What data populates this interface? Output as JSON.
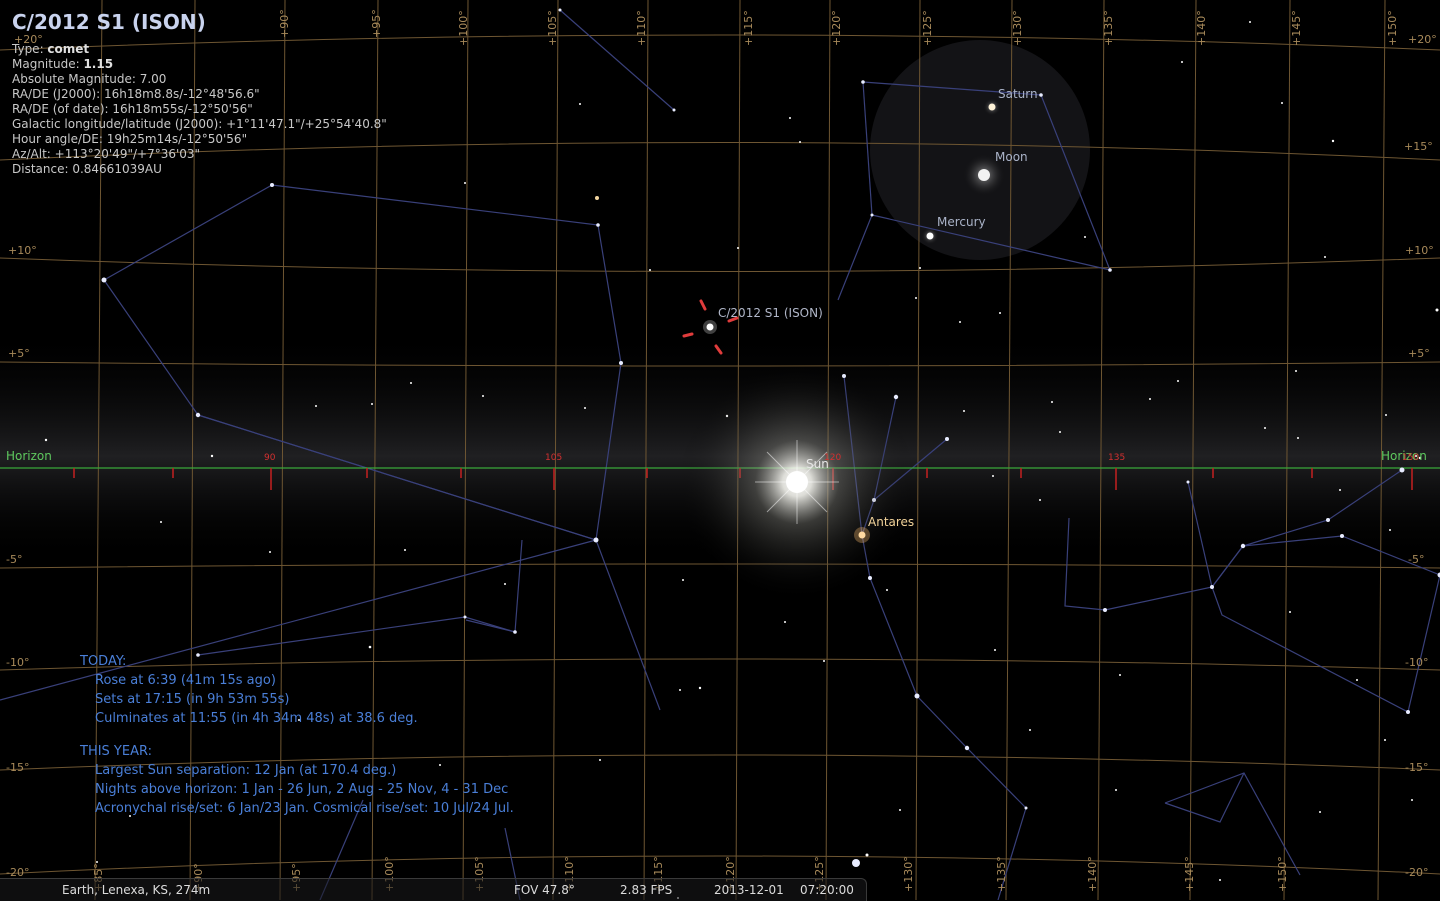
{
  "object_info": {
    "title": "C/2012 S1 (ISON)",
    "type_label": "Type: ",
    "type_value": "comet",
    "magnitude_label": "Magnitude: ",
    "magnitude_value": "1.15",
    "lines": [
      "Absolute Magnitude: 7.00",
      "RA/DE (J2000): 16h18m8.8s/-12°48'56.6\"",
      "RA/DE (of date): 16h18m55s/-12°50'56\"",
      "Galactic longitude/latitude (J2000): +1°11'47.1\"/+25°54'40.8\"",
      "Hour angle/DE: 19h25m14s/-12°50'56\"",
      "Az/Alt: +113°20'49\"/+7°36'03\"",
      "Distance: 0.84661039AU"
    ]
  },
  "sky_labels": {
    "saturn": "Saturn",
    "moon": "Moon",
    "mercury": "Mercury",
    "comet": "C/2012 S1 (ISON)",
    "sun": "Sun",
    "antares": "Antares",
    "horizon_left": "Horizon",
    "horizon_right": "Horizon"
  },
  "horizon_ticks": [
    "90",
    "105",
    "120",
    "135",
    "150"
  ],
  "alt_labels_left": [
    "+20°",
    "+15°",
    "+10°",
    "+5°",
    "-5°",
    "-10°",
    "-15°",
    "-20°"
  ],
  "alt_labels_right": [
    "+20°",
    "+15°",
    "+10°",
    "+5°",
    "-5°",
    "-10°",
    "-15°",
    "-20°"
  ],
  "az_labels_top": [
    "+90°",
    "+95°",
    "+100°",
    "+105°",
    "+110°",
    "+115°",
    "+120°",
    "+125°",
    "+130°",
    "+135°",
    "+140°",
    "+145°",
    "+150°"
  ],
  "az_labels_bottom": [
    "+85°",
    "+90°",
    "+95°",
    "+100°",
    "+105°",
    "+110°",
    "+115°",
    "+120°",
    "+125°",
    "+130°",
    "+135°",
    "+140°",
    "+145°",
    "+150°"
  ],
  "today_panel": {
    "today_heading": "TODAY:",
    "rose": "Rose at 6:39 (41m 15s ago)",
    "sets": "Sets at 17:15 (in 9h 53m 55s)",
    "culminates": "Culminates at 11:55 (in 4h 34m 48s) at 38.6 deg.",
    "year_heading": "THIS YEAR:",
    "largest_sep": "Largest Sun separation: 12 Jan (at 170.4 deg.)",
    "nights": "Nights above horizon:  1 Jan - 26 Jun, 2 Aug - 25 Nov, 4 - 31 Dec",
    "acronychal": "Acronychal rise/set: 6 Jan/23 Jan. Cosmical rise/set: 10 Jul/24 Jul."
  },
  "status_bar": {
    "location": "Earth, Lenexa, KS, 274m",
    "fov": "FOV 47.8°",
    "fps": "2.83 FPS",
    "date": "2013-12-01",
    "time": "07:20:00"
  },
  "colors": {
    "grid": "#6e5632",
    "constellation": "#39407a",
    "horizon": "#3aa83a",
    "cardinal_ticks": "#c42020",
    "comet_marker": "#e03c3c",
    "today_text": "#4a7fd8"
  }
}
